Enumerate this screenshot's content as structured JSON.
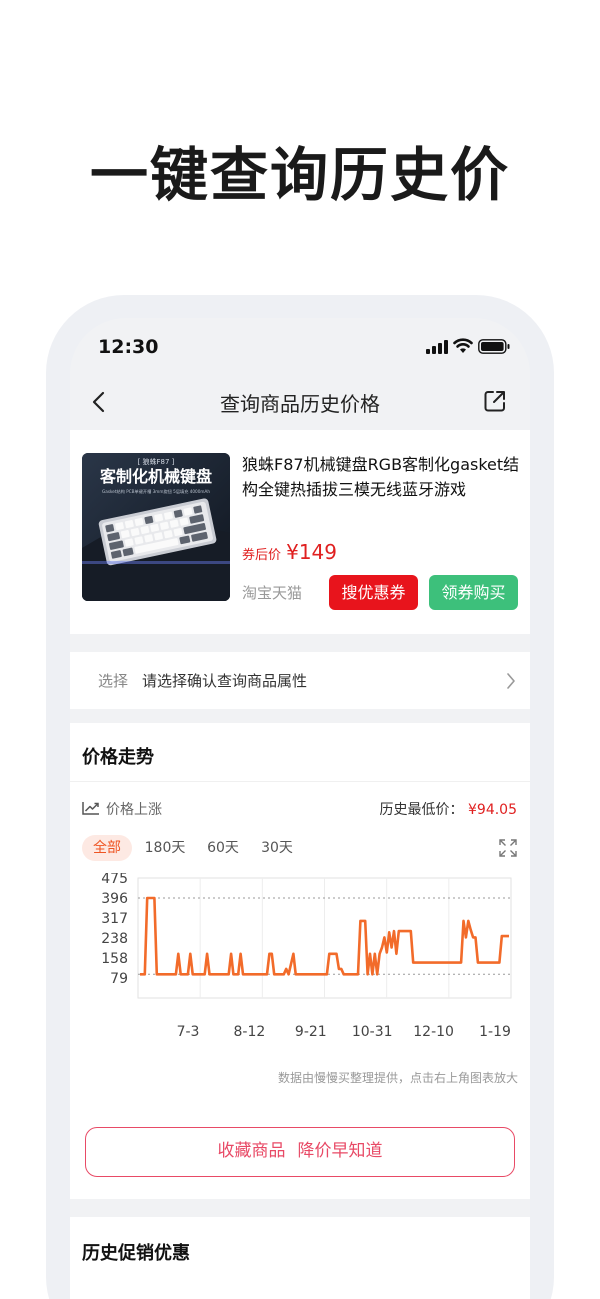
{
  "headline": "一键查询历史价",
  "status_bar": {
    "time": "12:30"
  },
  "navbar": {
    "title": "查询商品历史价格"
  },
  "product": {
    "image_banner_brand": "[ 狼蛛F87 ]",
    "image_banner_title": "客制化机械键盘",
    "image_banner_sub": "Gasket结构 PCB单键开槽 3mm旋钮 5层填充 4000mAh",
    "title": "狼蛛F87机械键盘RGB客制化gasket结构全键热插拔三模无线蓝牙游戏",
    "price_label": "券后价",
    "price": "¥149",
    "shop": "淘宝天猫",
    "coupon_button": "搜优惠券",
    "buy_button": "领券购买"
  },
  "select_row": {
    "label": "选择",
    "text": "请选择确认查询商品属性"
  },
  "price_trend": {
    "title": "价格走势",
    "trend_label": "价格上涨",
    "lowest_label": "历史最低价：",
    "lowest_value": "¥94.05",
    "tabs": [
      "全部",
      "180天",
      "60天",
      "30天"
    ],
    "active_tab": "全部",
    "note": "数据由慢慢买整理提供，点击右上角图表放大",
    "favorite_button": [
      "收藏商品",
      "降价早知道"
    ]
  },
  "chart_data": {
    "type": "line",
    "y_ticks": [
      "475",
      "396",
      "317",
      "238",
      "158",
      "79"
    ],
    "x_ticks": [
      "7-3",
      "8-12",
      "9-21",
      "10-31",
      "12-10",
      "1-19"
    ],
    "ylim": [
      0,
      475
    ],
    "reference_lines": [
      396,
      94.05
    ],
    "series": [
      {
        "color": "#f26b2a",
        "points": [
          [
            0,
            94
          ],
          [
            2,
            94
          ],
          [
            3,
            396
          ],
          [
            6,
            396
          ],
          [
            7,
            94
          ],
          [
            15,
            94
          ],
          [
            16,
            175
          ],
          [
            17,
            94
          ],
          [
            20,
            94
          ],
          [
            21,
            175
          ],
          [
            22,
            94
          ],
          [
            27,
            94
          ],
          [
            28,
            175
          ],
          [
            29,
            94
          ],
          [
            37,
            94
          ],
          [
            38,
            175
          ],
          [
            39,
            94
          ],
          [
            41,
            94
          ],
          [
            42,
            175
          ],
          [
            43,
            94
          ],
          [
            53,
            94
          ],
          [
            54,
            175
          ],
          [
            55,
            175
          ],
          [
            56,
            94
          ],
          [
            60,
            94
          ],
          [
            61,
            115
          ],
          [
            62,
            94
          ],
          [
            64,
            175
          ],
          [
            65,
            94
          ],
          [
            78,
            94
          ],
          [
            79,
            175
          ],
          [
            82,
            175
          ],
          [
            83,
            115
          ],
          [
            84,
            115
          ],
          [
            85,
            94
          ],
          [
            91,
            94
          ],
          [
            92,
            305
          ],
          [
            94,
            305
          ],
          [
            95,
            94
          ],
          [
            96,
            175
          ],
          [
            97,
            94
          ],
          [
            98,
            175
          ],
          [
            99,
            94
          ],
          [
            100,
            175
          ],
          [
            101,
            200
          ],
          [
            102,
            240
          ],
          [
            103,
            180
          ],
          [
            104,
            260
          ],
          [
            105,
            200
          ],
          [
            106,
            265
          ],
          [
            107,
            175
          ],
          [
            108,
            265
          ],
          [
            113,
            265
          ],
          [
            114,
            140
          ],
          [
            134,
            140
          ],
          [
            135,
            305
          ],
          [
            136,
            240
          ],
          [
            137,
            305
          ],
          [
            138,
            270
          ],
          [
            139,
            240
          ],
          [
            140,
            240
          ],
          [
            141,
            140
          ],
          [
            150,
            140
          ],
          [
            151,
            245
          ],
          [
            154,
            245
          ]
        ]
      }
    ]
  },
  "promo": {
    "title": "历史促销优惠"
  }
}
